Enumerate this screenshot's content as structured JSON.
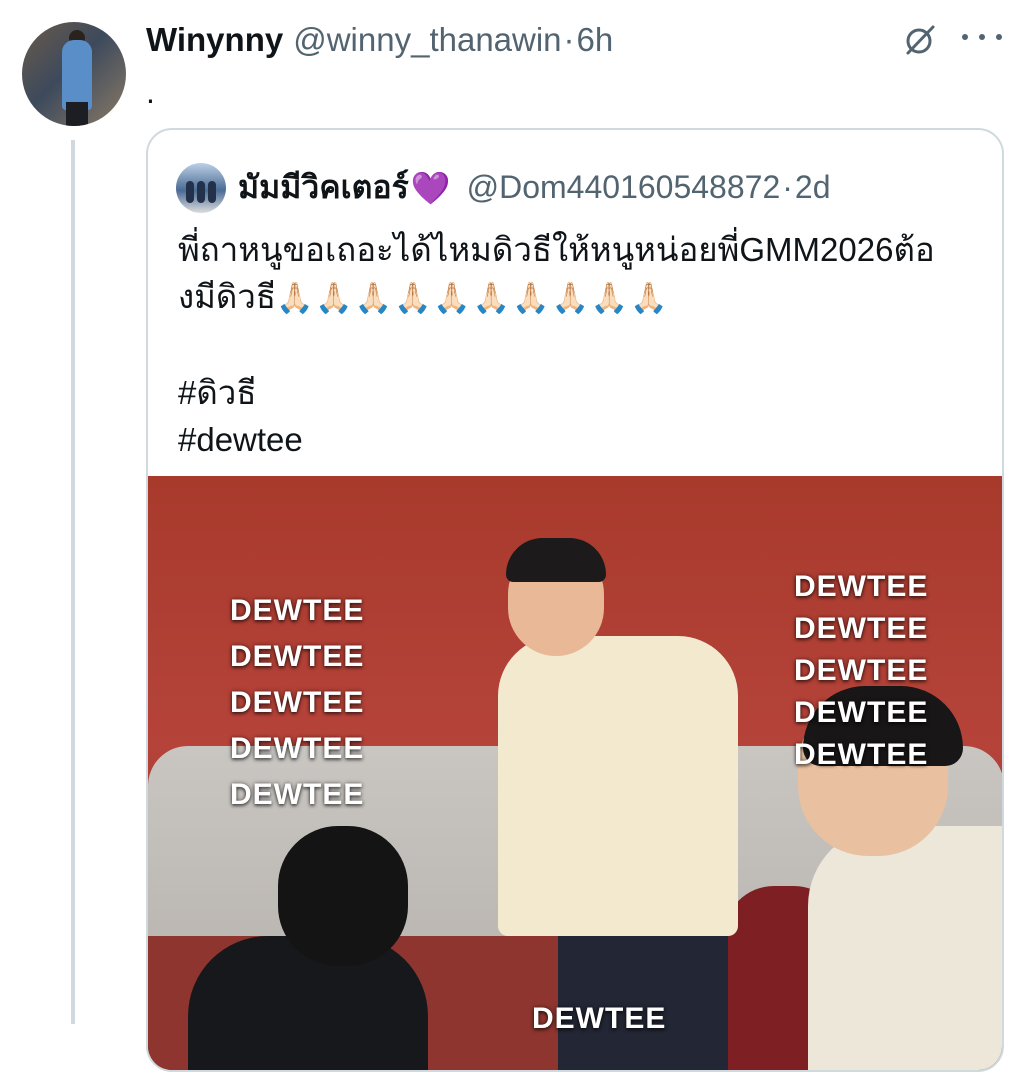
{
  "tweet": {
    "author_name": "Winynny",
    "author_handle": "@winny_thanawin",
    "separator": "·",
    "time": "6h",
    "text": ".",
    "icons": {
      "grok": "grok-icon",
      "more": "more-icon"
    }
  },
  "quote": {
    "author_name": "มัมมีวิคเตอร์",
    "author_emoji": "💜",
    "author_handle": "@Dom440160548872",
    "separator": "·",
    "time": "2d",
    "text_line1": "พี่ถาหนูขอเถอะได้ไหมดิวธีให้หนูหน่อยพี่GMM2026ต้อ",
    "text_line2": "งมีดิวธี",
    "pray_emojis": "🙏🏻🙏🏻🙏🏻🙏🏻🙏🏻🙏🏻🙏🏻🙏🏻🙏🏻🙏🏻",
    "hashtag1": "#ดิวธี",
    "hashtag2": "#dewtee"
  },
  "image": {
    "left_captions": [
      "DEWTEE",
      "DEWTEE",
      "DEWTEE",
      "DEWTEE",
      "DEWTEE"
    ],
    "right_captions": [
      "DEWTEE",
      "DEWTEE",
      "DEWTEE",
      "DEWTEE",
      "DEWTEE"
    ],
    "bottom_caption": "DEWTEE"
  }
}
